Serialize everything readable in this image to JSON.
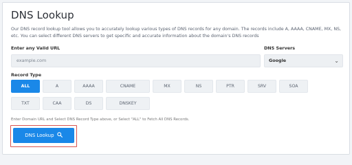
{
  "page": {
    "title": "DNS Lookup",
    "description": "Our DNS record lookup tool allows you to accurately lookup various types of DNS records for any domain. The records include A, AAAA, CNAME, MX, NS, etc. You can select different DNS servers to get specific and accurate information about the domain's DNS records"
  },
  "form": {
    "url_label": "Enter any Valid URL",
    "url_placeholder": "example.com",
    "dns_label": "DNS Servers",
    "dns_selected": "Google",
    "record_type_label": "Record Type",
    "record_types": [
      "ALL",
      "A",
      "AAAA",
      "CNAME",
      "MX",
      "NS",
      "PTR",
      "SRV",
      "SOA",
      "TXT",
      "CAA",
      "DS",
      "DNSKEY"
    ],
    "active_record_type": "ALL",
    "hint": "Enter Domain URL and Select DNS Record Type above, or Select \"ALL\" to Fetch All DNS Records.",
    "submit_label": "DNS Lookup"
  },
  "colors": {
    "accent": "#1a88e8",
    "highlight": "#d9534f"
  },
  "icons": {
    "submit": "search-icon",
    "select": "chevron-down-icon"
  }
}
